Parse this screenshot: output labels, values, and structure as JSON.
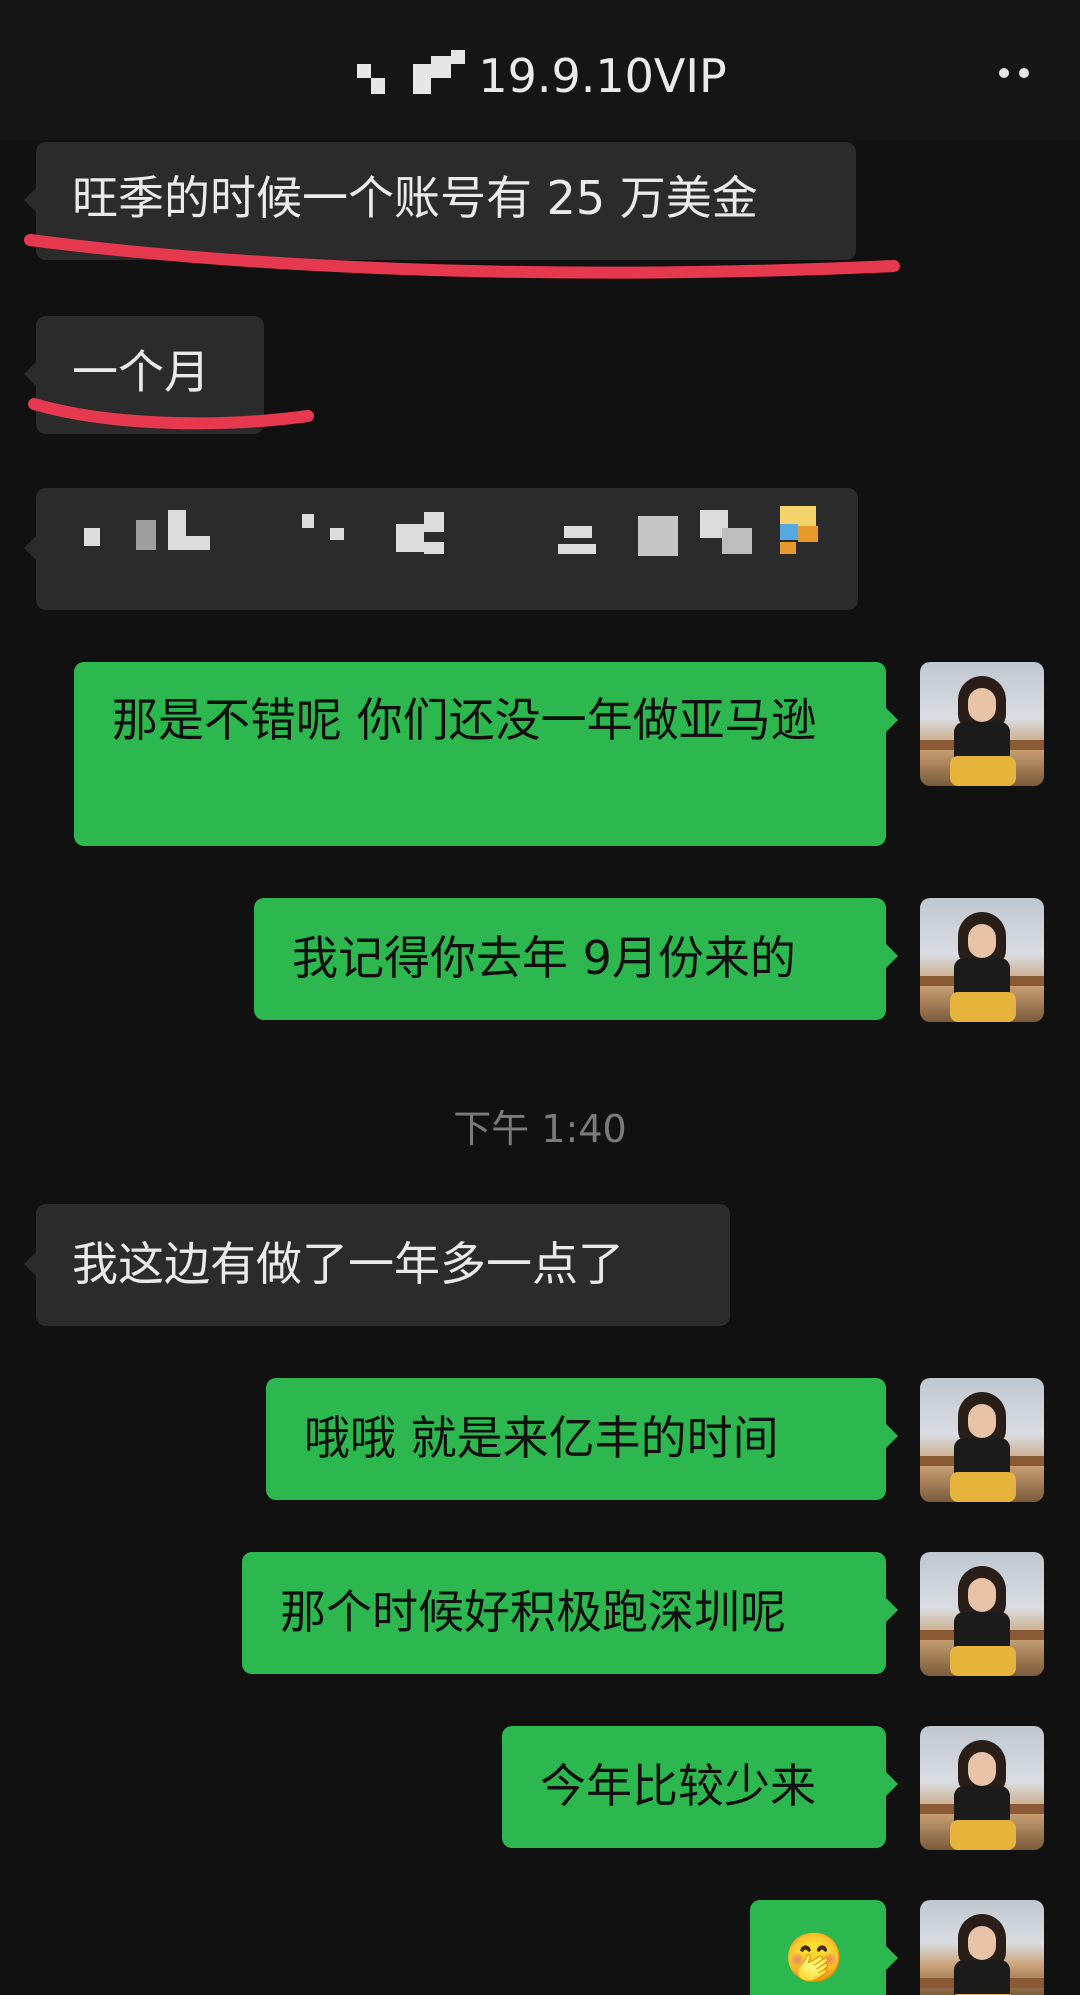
{
  "header": {
    "title": "19.9.10VIP",
    "more_icon": "more-dots-icon"
  },
  "messages": [
    {
      "id": "m1",
      "side": "in",
      "text": "旺季的时候一个账号有 25 万美金"
    },
    {
      "id": "m2",
      "side": "in",
      "text": "一个月"
    },
    {
      "id": "m3",
      "side": "in",
      "text": ""
    },
    {
      "id": "m4",
      "side": "out",
      "text": "那是不错呢 你们还没一年做亚马逊"
    },
    {
      "id": "m5",
      "side": "out",
      "text": "我记得你去年 9月份来的"
    },
    {
      "id": "m6",
      "side": "in",
      "text": "我这边有做了一年多一点了"
    },
    {
      "id": "m7",
      "side": "out",
      "text": "哦哦 就是来亿丰的时间"
    },
    {
      "id": "m8",
      "side": "out",
      "text": "那个时候好积极跑深圳呢"
    },
    {
      "id": "m9",
      "side": "out",
      "text": "今年比较少来"
    },
    {
      "id": "m10",
      "side": "out",
      "text": "🤭"
    }
  ],
  "timestamp": "下午 1:40",
  "colors": {
    "incoming_bubble": "#2b2b2b",
    "outgoing_bubble": "#2db84f",
    "annotation_red": "#e63950"
  }
}
